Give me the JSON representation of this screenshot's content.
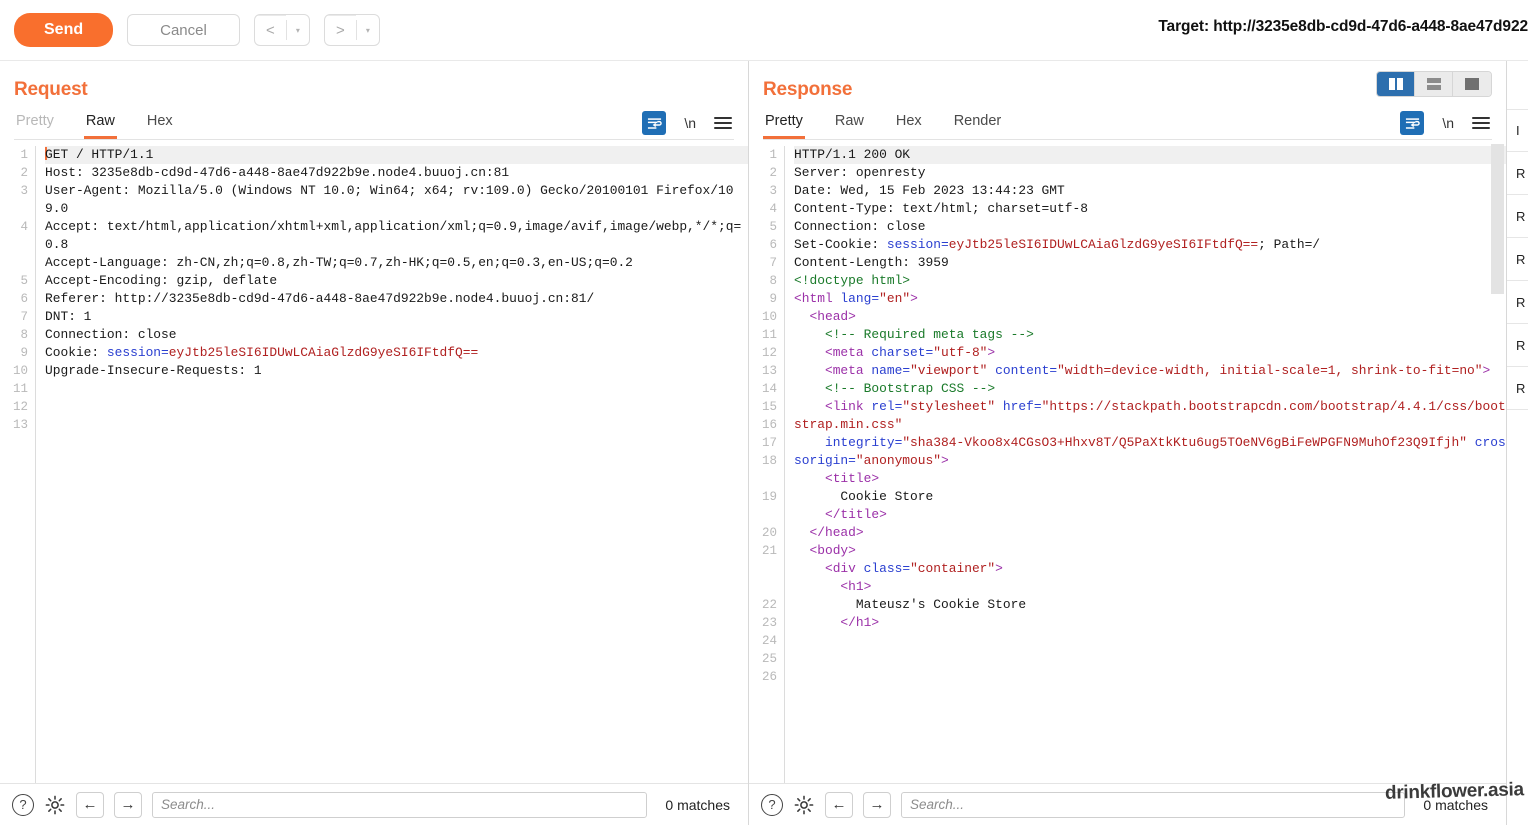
{
  "toolbar": {
    "send_label": "Send",
    "cancel_label": "Cancel",
    "prev_icon": "<",
    "next_icon": ">",
    "caret_icon": "▾",
    "target_label": "Target: http://3235e8db-cd9d-47d6-a448-8ae47d922"
  },
  "colors": {
    "accent_orange": "#f2703a",
    "send_button": "#f96f2d",
    "active_blue": "#2d6fae",
    "wrap_blue": "#1f6eb5",
    "string_red": "#b02020",
    "tag_purple": "#9b30a8",
    "attr_blue": "#2a3fd0",
    "comment_green": "#1a7a2a",
    "gutter_grey": "#b9b9b9"
  },
  "request": {
    "title": "Request",
    "tabs": [
      {
        "label": "Pretty",
        "active": false
      },
      {
        "label": "Raw",
        "active": true
      },
      {
        "label": "Hex",
        "active": false
      }
    ],
    "tool_icons": {
      "wrap": "word-wrap-icon",
      "newline": "\\n",
      "menu": "hamburger-menu-icon"
    },
    "line_numbers": [
      "1",
      "2",
      "3",
      "",
      "4",
      "",
      "",
      "5",
      "6",
      "7",
      "8",
      "9",
      "10",
      "11",
      "12",
      "13"
    ],
    "lines": [
      {
        "num": "1",
        "highlight": true,
        "caret": true,
        "segments": [
          {
            "t": "GET / HTTP/1.1",
            "c": "plain"
          }
        ]
      },
      {
        "num": "2",
        "segments": [
          {
            "t": "Host: 3235e8db-cd9d-47d6-a448-8ae47d922b9e.node4.buuoj.cn:81",
            "c": "plain"
          }
        ]
      },
      {
        "num": "3",
        "segments": [
          {
            "t": "User-Agent: Mozilla/5.0 (Windows NT 10.0; Win64; x64; rv:109.0) Gecko/20100101 Firefox/109.0",
            "c": "plain"
          }
        ]
      },
      {
        "num": "4",
        "segments": [
          {
            "t": "Accept: text/html,application/xhtml+xml,application/xml;q=0.9,image/avif,image/webp,*/*;q=0.8",
            "c": "plain"
          }
        ]
      },
      {
        "num": "5",
        "segments": [
          {
            "t": "Accept-Language: zh-CN,zh;q=0.8,zh-TW;q=0.7,zh-HK;q=0.5,en;q=0.3,en-US;q=0.2",
            "c": "plain"
          }
        ]
      },
      {
        "num": "6",
        "segments": [
          {
            "t": "Accept-Encoding: gzip, deflate",
            "c": "plain"
          }
        ]
      },
      {
        "num": "7",
        "segments": [
          {
            "t": "Referer: http://3235e8db-cd9d-47d6-a448-8ae47d922b9e.node4.buuoj.cn:81/",
            "c": "plain"
          }
        ]
      },
      {
        "num": "8",
        "segments": [
          {
            "t": "DNT: 1",
            "c": "plain"
          }
        ]
      },
      {
        "num": "9",
        "segments": [
          {
            "t": "Connection: close",
            "c": "plain"
          }
        ]
      },
      {
        "num": "10",
        "segments": [
          {
            "t": "Cookie: ",
            "c": "plain"
          },
          {
            "t": "session=",
            "c": "blue"
          },
          {
            "t": "eyJtb25leSI6IDUwLCAiaGlzdG9yeSI6IFtdfQ==",
            "c": "red"
          }
        ]
      },
      {
        "num": "11",
        "segments": [
          {
            "t": "Upgrade-Insecure-Requests: 1",
            "c": "plain"
          }
        ]
      },
      {
        "num": "12",
        "segments": [
          {
            "t": "",
            "c": "plain"
          }
        ]
      },
      {
        "num": "13",
        "segments": [
          {
            "t": "",
            "c": "plain"
          }
        ]
      }
    ],
    "status": {
      "help_icon": "?",
      "gear_icon": "gear-icon",
      "back_icon": "←",
      "forward_icon": "→",
      "search_placeholder": "Search...",
      "search_value": "",
      "matches": "0 matches"
    }
  },
  "response": {
    "title": "Response",
    "tabs": [
      {
        "label": "Pretty",
        "active": true
      },
      {
        "label": "Raw",
        "active": false
      },
      {
        "label": "Hex",
        "active": false
      },
      {
        "label": "Render",
        "active": false
      }
    ],
    "layout_buttons": [
      {
        "name": "layout-side-by-side",
        "active": true
      },
      {
        "name": "layout-stacked",
        "active": false
      },
      {
        "name": "layout-single",
        "active": false
      }
    ],
    "tool_icons": {
      "wrap": "word-wrap-icon",
      "newline": "\\n",
      "menu": "hamburger-menu-icon"
    },
    "lines": [
      {
        "num": "1",
        "highlight": true,
        "segments": [
          {
            "t": "HTTP/1.1 200 OK",
            "c": "plain"
          }
        ]
      },
      {
        "num": "2",
        "segments": [
          {
            "t": "Server: openresty",
            "c": "plain"
          }
        ]
      },
      {
        "num": "3",
        "segments": [
          {
            "t": "Date: Wed, 15 Feb 2023 13:44:23 GMT",
            "c": "plain"
          }
        ]
      },
      {
        "num": "4",
        "segments": [
          {
            "t": "Content-Type: text/html; charset=utf-8",
            "c": "plain"
          }
        ]
      },
      {
        "num": "5",
        "segments": [
          {
            "t": "Connection: close",
            "c": "plain"
          }
        ]
      },
      {
        "num": "6",
        "segments": [
          {
            "t": "Set-Cookie: ",
            "c": "plain"
          },
          {
            "t": "session=",
            "c": "blue"
          },
          {
            "t": "eyJtb25leSI6IDUwLCAiaGlzdG9yeSI6IFtdfQ==",
            "c": "red"
          },
          {
            "t": "; Path=/",
            "c": "plain"
          }
        ]
      },
      {
        "num": "7",
        "segments": [
          {
            "t": "Content-Length: 3959",
            "c": "plain"
          }
        ]
      },
      {
        "num": "8",
        "segments": [
          {
            "t": "",
            "c": "plain"
          }
        ]
      },
      {
        "num": "9",
        "segments": [
          {
            "t": "<!doctype html>",
            "c": "green"
          }
        ]
      },
      {
        "num": "10",
        "segments": [
          {
            "t": "<html ",
            "c": "purple"
          },
          {
            "t": "lang=",
            "c": "blue"
          },
          {
            "t": "\"en\"",
            "c": "red"
          },
          {
            "t": ">",
            "c": "purple"
          }
        ]
      },
      {
        "num": "11",
        "segments": [
          {
            "t": "",
            "c": "plain"
          }
        ]
      },
      {
        "num": "12",
        "segments": [
          {
            "t": "  <head>",
            "c": "purple"
          }
        ]
      },
      {
        "num": "13",
        "segments": [
          {
            "t": "    <!-- Required meta tags -->",
            "c": "green"
          }
        ]
      },
      {
        "num": "14",
        "segments": [
          {
            "t": "    <meta ",
            "c": "purple"
          },
          {
            "t": "charset=",
            "c": "blue"
          },
          {
            "t": "\"utf-8\"",
            "c": "red"
          },
          {
            "t": ">",
            "c": "purple"
          }
        ]
      },
      {
        "num": "15",
        "segments": [
          {
            "t": "    <meta ",
            "c": "purple"
          },
          {
            "t": "name=",
            "c": "blue"
          },
          {
            "t": "\"viewport\"",
            "c": "red"
          },
          {
            "t": " ",
            "c": "plain"
          },
          {
            "t": "content=",
            "c": "blue"
          },
          {
            "t": "\"width=device-width, initial-scale=1, shrink-to-fit=no\"",
            "c": "red"
          },
          {
            "t": ">",
            "c": "purple"
          }
        ]
      },
      {
        "num": "16",
        "segments": [
          {
            "t": "",
            "c": "plain"
          }
        ]
      },
      {
        "num": "17",
        "segments": [
          {
            "t": "    <!-- Bootstrap CSS -->",
            "c": "green"
          }
        ]
      },
      {
        "num": "18",
        "segments": [
          {
            "t": "    <link ",
            "c": "purple"
          },
          {
            "t": "rel=",
            "c": "blue"
          },
          {
            "t": "\"stylesheet\"",
            "c": "red"
          },
          {
            "t": " ",
            "c": "plain"
          },
          {
            "t": "href=",
            "c": "blue"
          },
          {
            "t": "\"https://stackpath.bootstrapcdn.com/bootstrap/4.4.1/css/bootstrap.min.css\"",
            "c": "red"
          }
        ]
      },
      {
        "num": "19",
        "segments": [
          {
            "t": "    ",
            "c": "plain"
          },
          {
            "t": "integrity=",
            "c": "blue"
          },
          {
            "t": "\"sha384-Vkoo8x4CGsO3+Hhxv8T/Q5PaXtkKtu6ug5TOeNV6gBiFeWPGFN9MuhOf23Q9Ifjh\"",
            "c": "red"
          },
          {
            "t": " ",
            "c": "plain"
          },
          {
            "t": "crossorigin=",
            "c": "blue"
          },
          {
            "t": "\"anonymous\"",
            "c": "red"
          },
          {
            "t": ">",
            "c": "purple"
          }
        ]
      },
      {
        "num": "20",
        "segments": [
          {
            "t": "",
            "c": "plain"
          }
        ]
      },
      {
        "num": "21",
        "segments": [
          {
            "t": "    <title>",
            "c": "purple"
          },
          {
            "t": "\n      Cookie Store\n    ",
            "c": "plain"
          },
          {
            "t": "</title>",
            "c": "purple"
          }
        ]
      },
      {
        "num": "22",
        "segments": [
          {
            "t": "  </head>",
            "c": "purple"
          }
        ]
      },
      {
        "num": "23",
        "segments": [
          {
            "t": "",
            "c": "plain"
          }
        ]
      },
      {
        "num": "24",
        "segments": [
          {
            "t": "  <body>",
            "c": "purple"
          }
        ]
      },
      {
        "num": "25",
        "segments": [
          {
            "t": "    <div ",
            "c": "purple"
          },
          {
            "t": "class=",
            "c": "blue"
          },
          {
            "t": "\"container\"",
            "c": "red"
          },
          {
            "t": ">",
            "c": "purple"
          }
        ]
      },
      {
        "num": "26",
        "segments": [
          {
            "t": "      <h1>",
            "c": "purple"
          },
          {
            "t": "\n        Mateusz's Cookie Store\n      ",
            "c": "plain"
          },
          {
            "t": "</h1>",
            "c": "purple"
          }
        ]
      }
    ],
    "status": {
      "help_icon": "?",
      "gear_icon": "gear-icon",
      "back_icon": "←",
      "forward_icon": "→",
      "search_placeholder": "Search...",
      "search_value": "",
      "matches": "0 matches"
    }
  },
  "inspector": {
    "rows": [
      "I",
      "R",
      "R",
      "R",
      "R",
      "R",
      "R"
    ]
  },
  "watermark": {
    "text": "drinkflower.asia"
  }
}
